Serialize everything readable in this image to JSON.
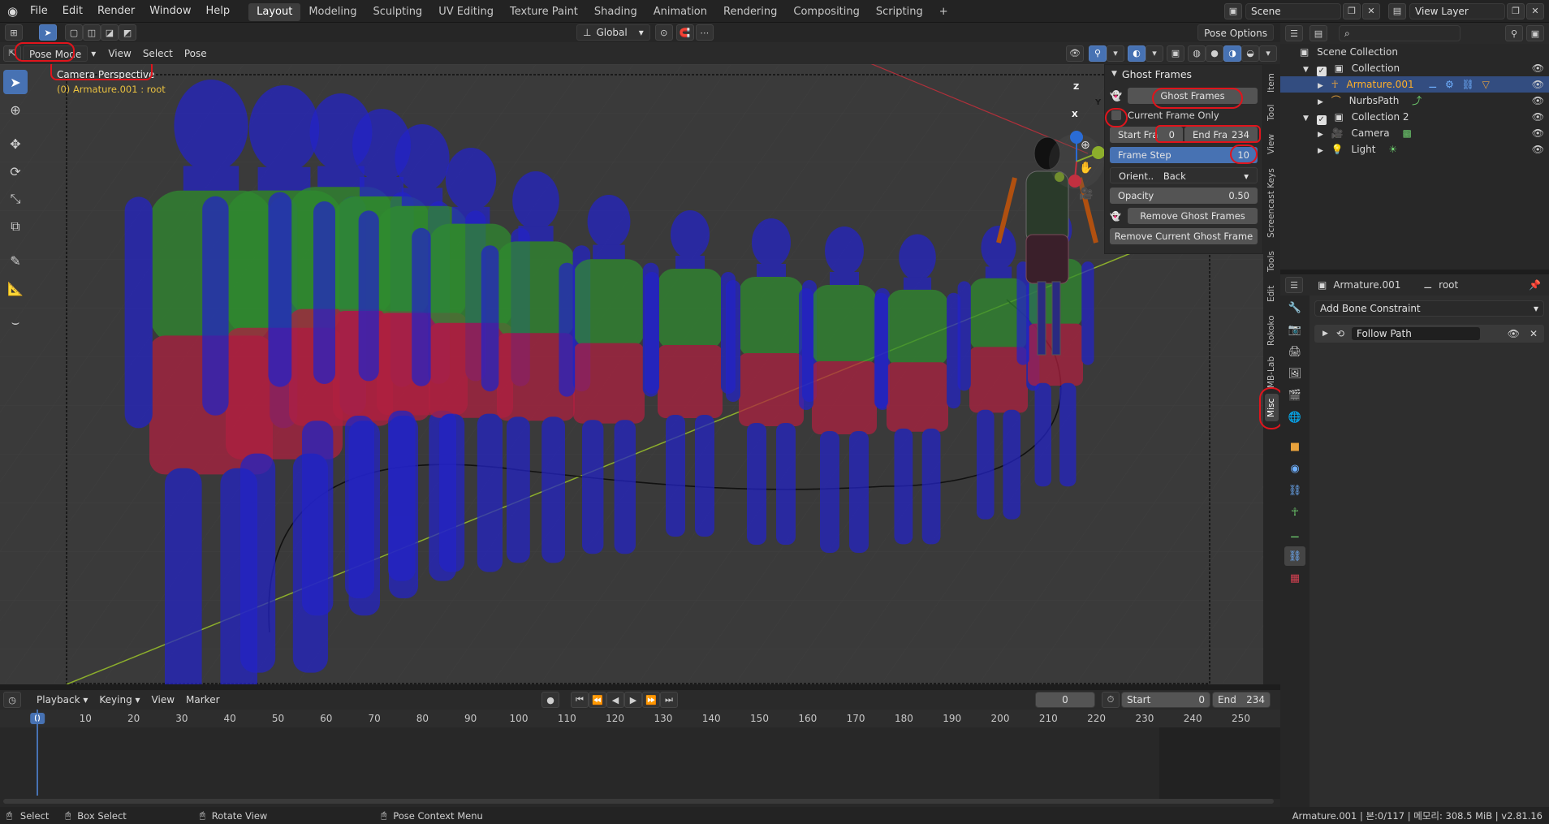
{
  "menubar": {
    "items": [
      "File",
      "Edit",
      "Render",
      "Window",
      "Help"
    ],
    "workspaces": [
      "Layout",
      "Modeling",
      "Sculpting",
      "UV Editing",
      "Texture Paint",
      "Shading",
      "Animation",
      "Rendering",
      "Compositing",
      "Scripting"
    ],
    "active_workspace": "Layout",
    "add_tab": "+",
    "scene": "Scene",
    "view_layer": "View Layer"
  },
  "viewport_header": {
    "mode": "Pose Mode",
    "menus": [
      "View",
      "Select",
      "Pose"
    ],
    "transform_orientation": "Global",
    "pose_options": "Pose Options"
  },
  "viewport": {
    "camera_label": "Camera Perspective",
    "active_object": "(0) Armature.001 : root",
    "axis_x": "X",
    "axis_y": "Y",
    "axis_z": "Z"
  },
  "ghost_panel": {
    "title": "Ghost Frames",
    "ghost_button": "Ghost Frames",
    "current_frame_only": "Current Frame Only",
    "current_frame_only_checked": false,
    "start_label": "Start Fra",
    "start_value": "0",
    "end_label": "End Fra",
    "end_value": "234",
    "frame_step_label": "Frame Step",
    "frame_step_value": "10",
    "orient_label": "Orient..",
    "orient_value": "Back",
    "opacity_label": "Opacity",
    "opacity_value": "0.50",
    "remove_all": "Remove Ghost Frames",
    "remove_current": "Remove Current Ghost Frame"
  },
  "sidebar_tabs": [
    "Item",
    "Tool",
    "View",
    "Screencast Keys",
    "Tools",
    "Edit",
    "Rokoko",
    "MB-Lab",
    "Misc"
  ],
  "active_sidebar_tab": "Misc",
  "timeline": {
    "menus": [
      "Playback",
      "Keying",
      "View",
      "Marker"
    ],
    "current_frame": "0",
    "start_label": "Start",
    "start_value": "0",
    "end_label": "End",
    "end_value": "234",
    "ticks": [
      "0",
      "10",
      "20",
      "30",
      "40",
      "50",
      "60",
      "70",
      "80",
      "90",
      "100",
      "110",
      "120",
      "130",
      "140",
      "150",
      "160",
      "170",
      "180",
      "190",
      "200",
      "210",
      "220",
      "230",
      "240",
      "250"
    ],
    "playhead_label": "0"
  },
  "statusbar": {
    "select": "Select",
    "box_select": "Box Select",
    "rotate_view": "Rotate View",
    "context_menu": "Pose Context Menu",
    "info": "Armature.001 | 본:0/117 | 메모리: 308.5 MiB | v2.81.16"
  },
  "outliner": {
    "root": "Scene Collection",
    "rows": [
      {
        "label": "Collection"
      },
      {
        "label": "Armature.001"
      },
      {
        "label": "NurbsPath"
      },
      {
        "label": "Collection 2"
      },
      {
        "label": "Camera"
      },
      {
        "label": "Light"
      }
    ]
  },
  "properties": {
    "object": "Armature.001",
    "bone": "root",
    "add_constraint": "Add Bone Constraint",
    "constraint_name": "Follow Path"
  },
  "colors": {
    "accent": "#4772b3",
    "annotation": "#e0141c",
    "ghost_blue": "#2323c8",
    "ghost_green": "#2f8c2f",
    "ghost_red": "#b02040"
  }
}
